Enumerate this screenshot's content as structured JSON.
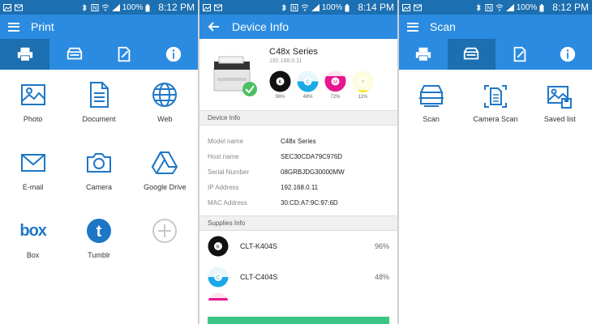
{
  "status": {
    "time1": "8:12 PM",
    "time2": "8:14 PM",
    "time3": "8:12 PM",
    "battery": "100%"
  },
  "print_screen": {
    "title": "Print",
    "items": [
      {
        "label": "Photo",
        "icon": "photo-icon"
      },
      {
        "label": "Document",
        "icon": "document-icon"
      },
      {
        "label": "Web",
        "icon": "globe-icon"
      },
      {
        "label": "E-mail",
        "icon": "envelope-icon"
      },
      {
        "label": "Camera",
        "icon": "camera-icon"
      },
      {
        "label": "Google Drive",
        "icon": "google-drive-icon"
      },
      {
        "label": "Box",
        "icon": "box-logo",
        "logo_text": "box"
      },
      {
        "label": "Tumblr",
        "icon": "tumblr-icon",
        "logo_text": "t"
      },
      {
        "label": "",
        "icon": "add-icon"
      }
    ]
  },
  "device_screen": {
    "title": "Device Info",
    "device_name": "C48x Series",
    "device_ip": "192.168.0.11",
    "toners": [
      {
        "letter": "K",
        "percent": "96%",
        "color": "#111111"
      },
      {
        "letter": "C",
        "percent": "48%",
        "color": "#1aa9e6"
      },
      {
        "letter": "M",
        "percent": "72%",
        "color": "#e6178f"
      },
      {
        "letter": "Y",
        "percent": "11%",
        "color": "#f2e600"
      }
    ],
    "device_info_header": "Device Info",
    "info_rows": [
      {
        "key": "Model name",
        "value": "C48x Series"
      },
      {
        "key": "Host name",
        "value": "SEC30CDA79C976D"
      },
      {
        "key": "Serial Number",
        "value": "08GRBJDG30000MW"
      },
      {
        "key": "IP Address",
        "value": "192.168.0.11"
      },
      {
        "key": "MAC Address",
        "value": "30:CD:A7:9C:97:6D"
      }
    ],
    "supplies_header": "Supplies Info",
    "supplies": [
      {
        "name": "CLT-K404S",
        "percent": "96%",
        "letter": "K",
        "color": "#111111"
      },
      {
        "name": "CLT-C404S",
        "percent": "48%",
        "letter": "C",
        "color": "#1aa9e6"
      }
    ]
  },
  "scan_screen": {
    "title": "Scan",
    "items": [
      {
        "label": "Scan",
        "icon": "scanner-icon"
      },
      {
        "label": "Camera Scan",
        "icon": "camera-scan-icon"
      },
      {
        "label": "Saved list",
        "icon": "saved-list-icon"
      }
    ]
  },
  "colors": {
    "appbar": "#2a8be0",
    "statusbar": "#1c6fb0",
    "icon_blue": "#1e77c6",
    "green": "#3cc487"
  }
}
